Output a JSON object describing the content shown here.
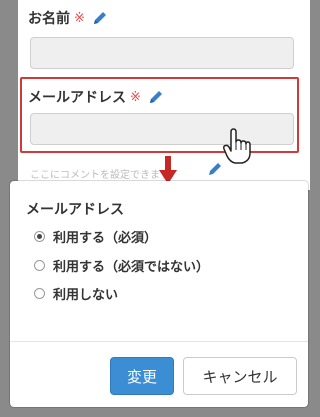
{
  "form": {
    "name_label": "お名前",
    "required_mark": "※",
    "email_label": "メールアドレス",
    "comment_text": "ここにコメントを設定できます。"
  },
  "dialog": {
    "title": "メールアドレス",
    "options": [
      {
        "label": "利用する（必須）",
        "selected": true
      },
      {
        "label": "利用する（必須ではない）",
        "selected": false
      },
      {
        "label": "利用しない",
        "selected": false
      }
    ],
    "change_button": "変更",
    "cancel_button": "キャンセル"
  },
  "colors": {
    "accent": "#3b8dd4",
    "required": "#e05050",
    "highlight": "#d03a3a"
  }
}
